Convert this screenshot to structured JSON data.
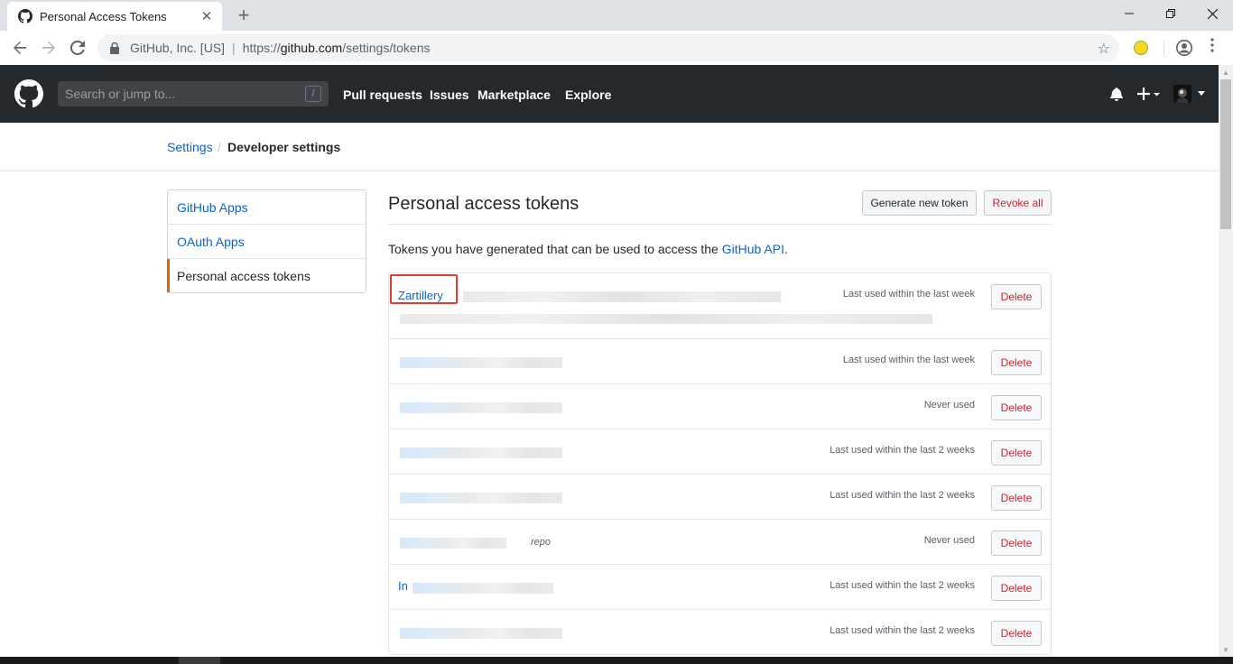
{
  "browser": {
    "tab_title": "Personal Access Tokens",
    "origin": "GitHub, Inc. [US]",
    "url_scheme": "https://",
    "url_host": "github.com",
    "url_path": "/settings/tokens"
  },
  "header": {
    "search_placeholder": "Search or jump to...",
    "search_shortcut": "/",
    "nav": [
      "Pull requests",
      "Issues",
      "Marketplace",
      "Explore"
    ]
  },
  "breadcrumb": {
    "settings": "Settings",
    "separator": "/",
    "current": "Developer settings"
  },
  "sidebar": {
    "items": [
      {
        "label": "GitHub Apps"
      },
      {
        "label": "OAuth Apps"
      },
      {
        "label": "Personal access tokens"
      }
    ]
  },
  "main": {
    "title": "Personal access tokens",
    "generate_button": "Generate new token",
    "revoke_button": "Revoke all",
    "intro_text": "Tokens you have generated that can be used to access the ",
    "intro_link": "GitHub API",
    "intro_end": ".",
    "delete_label": "Delete",
    "tokens": [
      {
        "name": "Zartillery",
        "last_used": "Last used within the last week"
      },
      {
        "name": "",
        "last_used": "Last used within the last week"
      },
      {
        "name": "",
        "last_used": "Never used"
      },
      {
        "name": "",
        "last_used": "Last used within the last 2 weeks"
      },
      {
        "name": "",
        "last_used": "Last used within the last 2 weeks"
      },
      {
        "name": "",
        "last_used": "Never used",
        "note": "repo"
      },
      {
        "name": "In",
        "last_used": "Last used within the last 2 weeks"
      },
      {
        "name": "",
        "last_used": "Last used within the last 2 weeks"
      }
    ]
  },
  "colors": {
    "header_bg": "#24292e",
    "link": "#0366d6",
    "danger": "#cb2431",
    "selected_accent": "#e36209",
    "highlight_box": "#e53935"
  }
}
